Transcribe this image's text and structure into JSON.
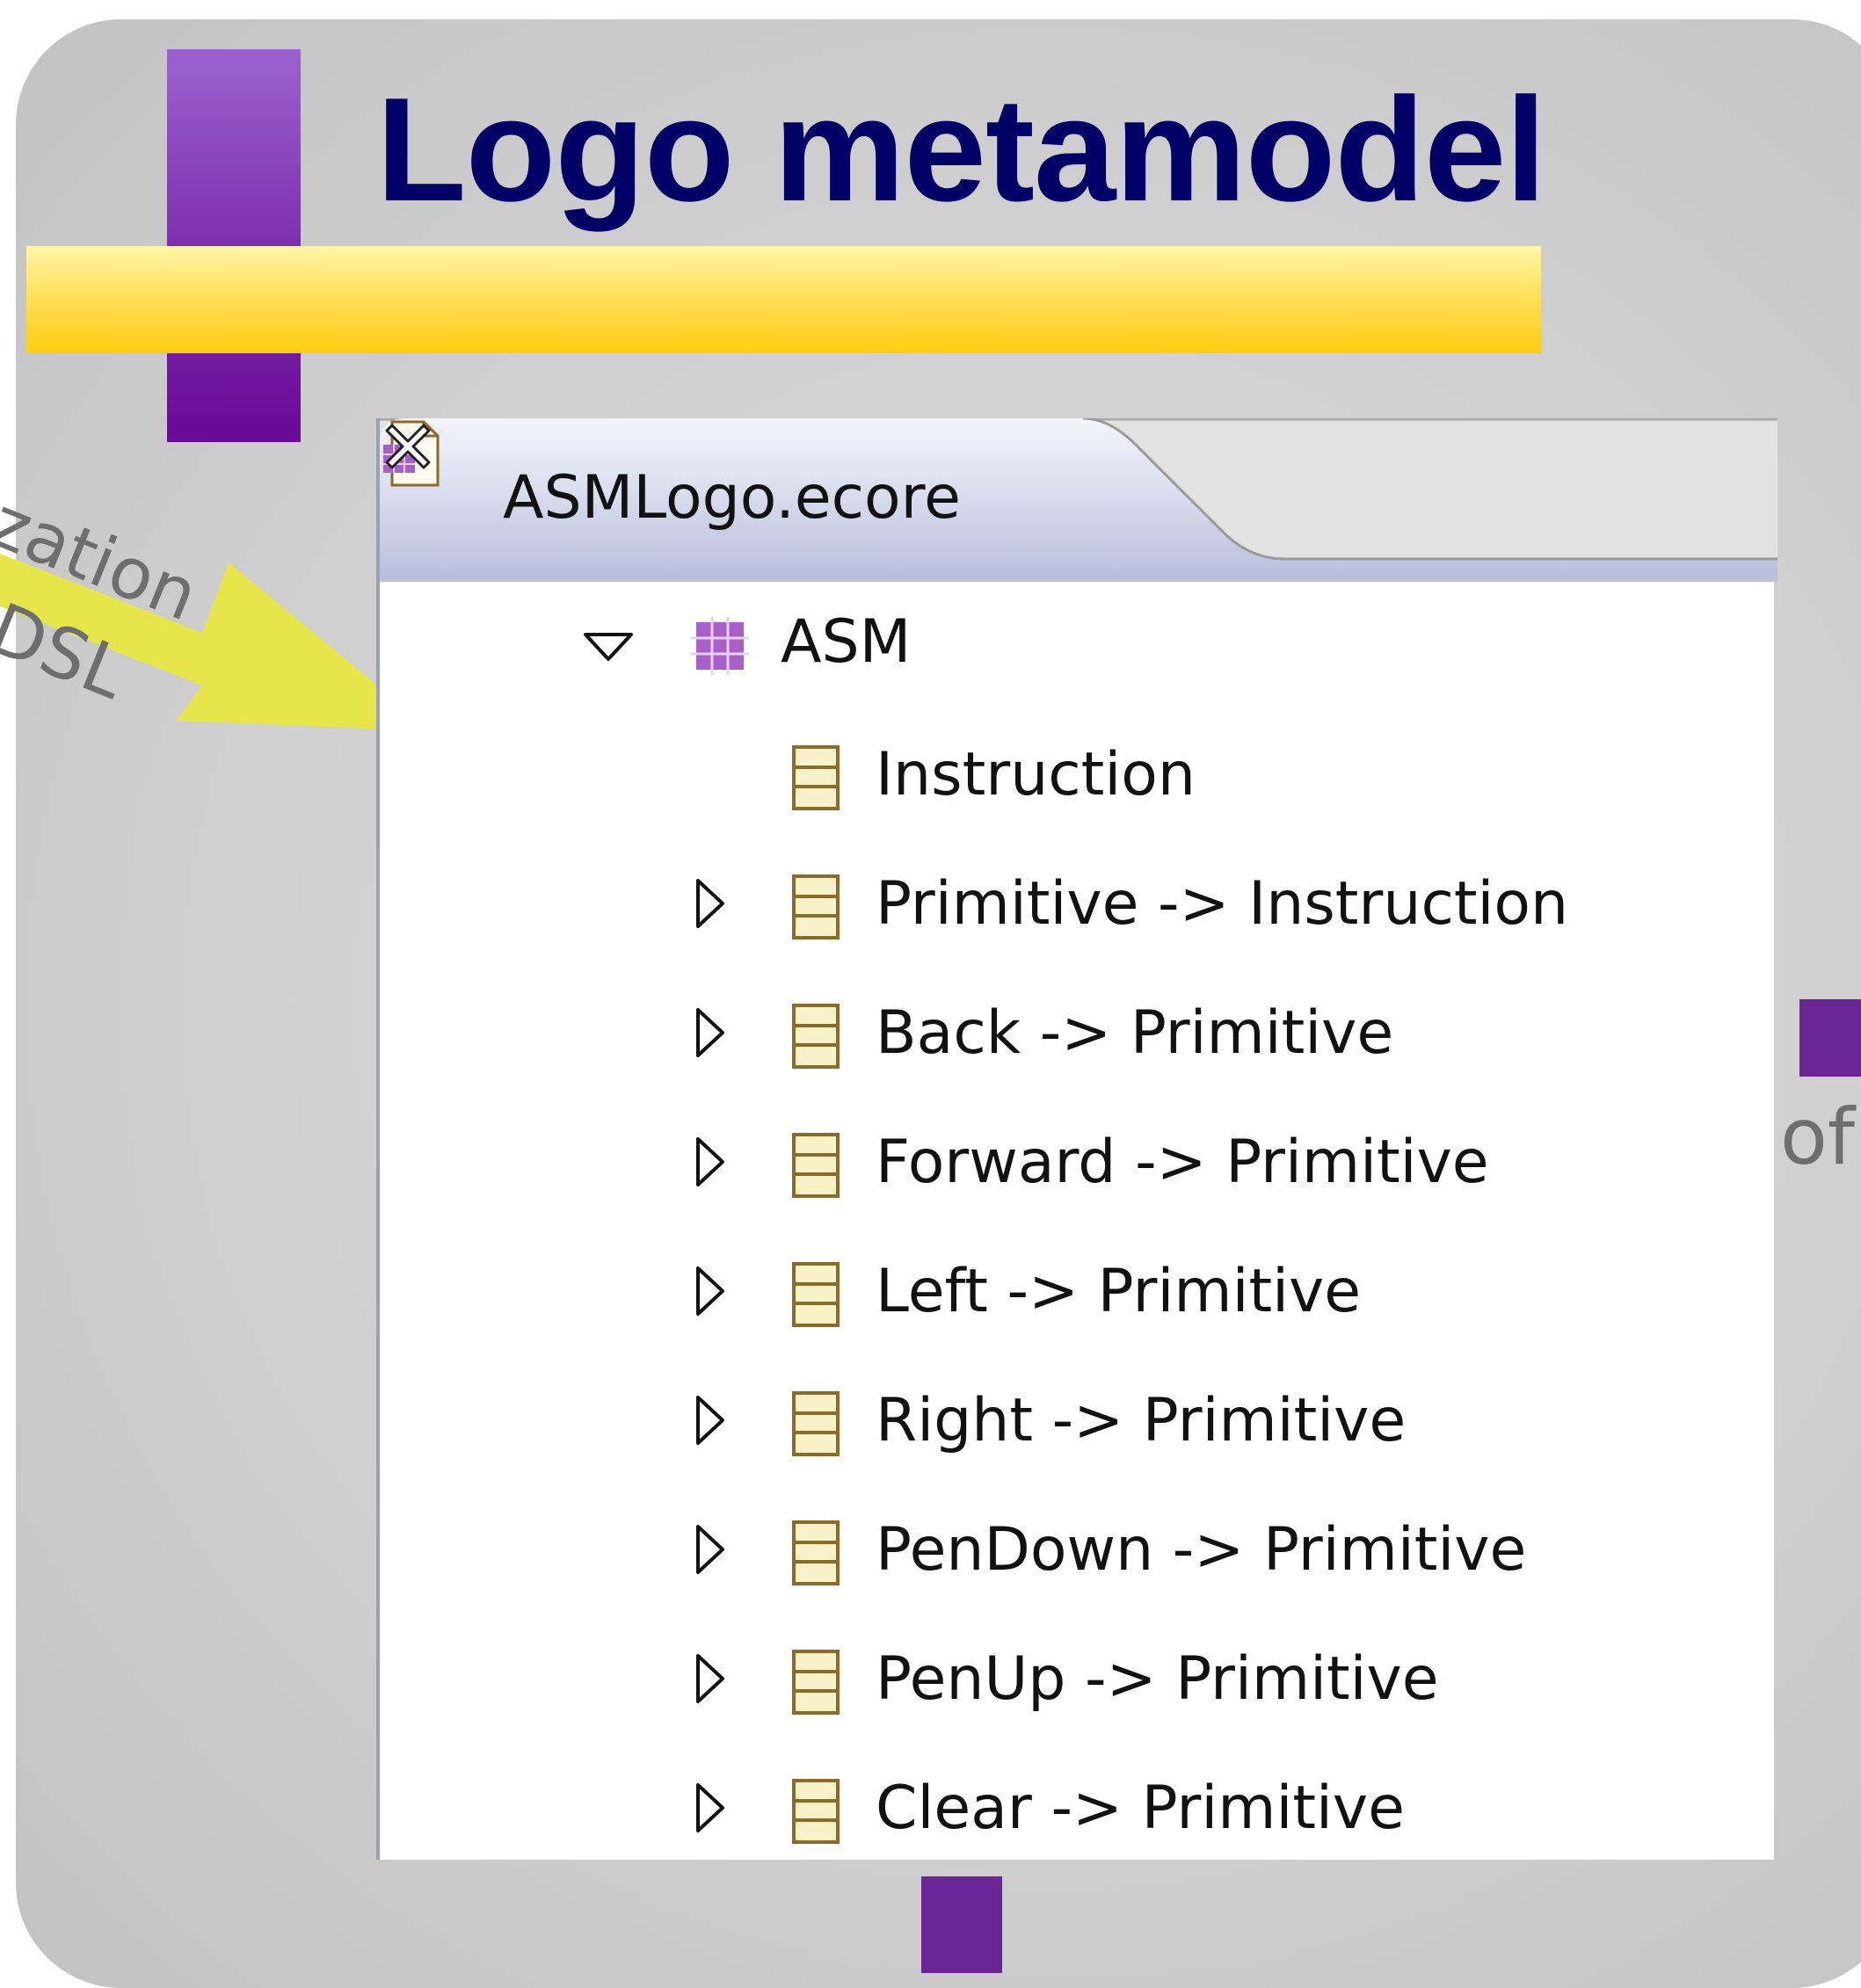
{
  "slide": {
    "title": "Logo metamodel",
    "left_text_line1": "ization",
    "left_text_line2": "DSL",
    "right_text": "of"
  },
  "editor": {
    "tab_label": "ASMLogo.ecore",
    "tree": {
      "root_label": "ASM",
      "items": [
        {
          "label": "Instruction",
          "expandable": false
        },
        {
          "label": "Primitive -> Instruction",
          "expandable": true
        },
        {
          "label": "Back -> Primitive",
          "expandable": true
        },
        {
          "label": "Forward -> Primitive",
          "expandable": true
        },
        {
          "label": "Left -> Primitive",
          "expandable": true
        },
        {
          "label": "Right -> Primitive",
          "expandable": true
        },
        {
          "label": "PenDown -> Primitive",
          "expandable": true
        },
        {
          "label": "PenUp -> Primitive",
          "expandable": true
        },
        {
          "label": "Clear -> Primitive",
          "expandable": true
        }
      ]
    }
  },
  "colors": {
    "title": "#000066",
    "purple_accent": "#6a2596",
    "yellow_bar": "#ffcc10",
    "arrow": "#e6e64a"
  },
  "icons": {
    "package": "epackage-icon",
    "class": "eclass-icon",
    "file": "ecore-file-icon",
    "close": "close-icon"
  }
}
